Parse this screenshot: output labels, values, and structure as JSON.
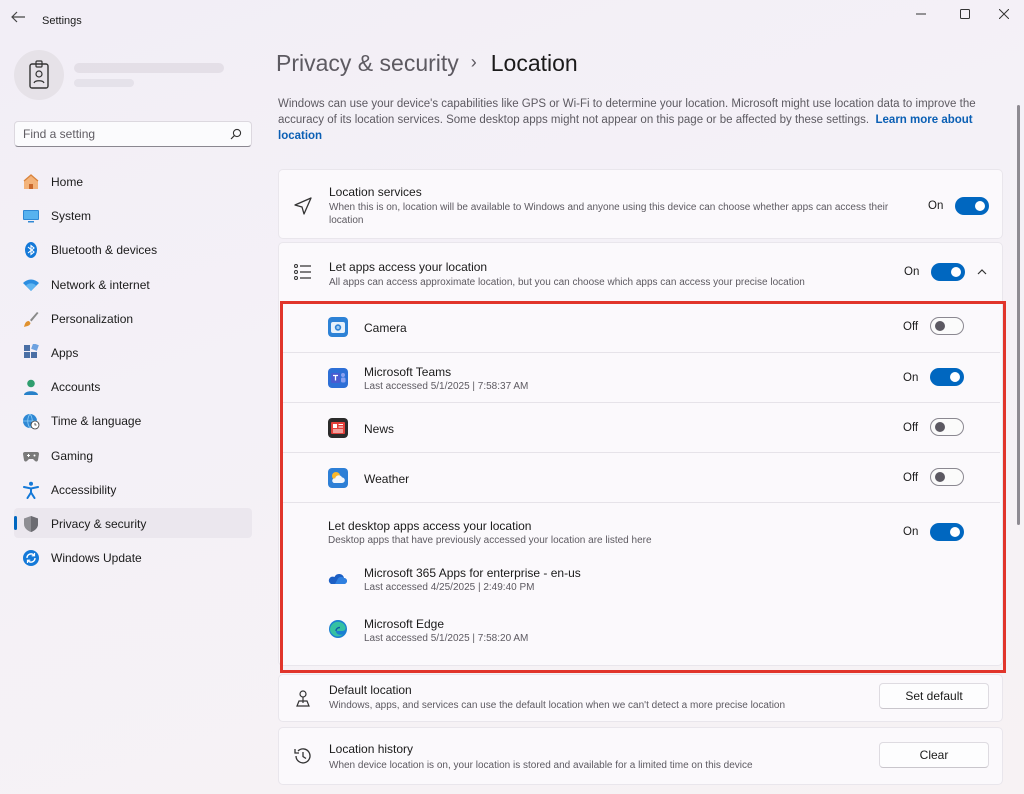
{
  "window": {
    "title": "Settings"
  },
  "search": {
    "placeholder": "Find a setting"
  },
  "sidebar": {
    "items": [
      {
        "label": "Home",
        "icon": "home-icon"
      },
      {
        "label": "System",
        "icon": "system-icon"
      },
      {
        "label": "Bluetooth & devices",
        "icon": "bluetooth-icon"
      },
      {
        "label": "Network & internet",
        "icon": "wifi-icon"
      },
      {
        "label": "Personalization",
        "icon": "brush-icon"
      },
      {
        "label": "Apps",
        "icon": "apps-icon"
      },
      {
        "label": "Accounts",
        "icon": "accounts-icon"
      },
      {
        "label": "Time & language",
        "icon": "globe-clock-icon"
      },
      {
        "label": "Gaming",
        "icon": "gamepad-icon"
      },
      {
        "label": "Accessibility",
        "icon": "accessibility-icon"
      },
      {
        "label": "Privacy & security",
        "icon": "shield-icon",
        "active": true
      },
      {
        "label": "Windows Update",
        "icon": "update-icon"
      }
    ]
  },
  "breadcrumb": {
    "parent": "Privacy & security",
    "separator": "›",
    "current": "Location"
  },
  "intro": {
    "text": "Windows can use your device's capabilities like GPS or Wi-Fi to determine your location. Microsoft might use location data to improve the accuracy of its location services. Some desktop apps might not appear on this page or be affected by these settings.",
    "link": "Learn more about location"
  },
  "location_services": {
    "title": "Location services",
    "description": "When this is on, location will be available to Windows and anyone using this device can choose whether apps can access their location",
    "state": "On",
    "on": true
  },
  "let_apps": {
    "title": "Let apps access your location",
    "description": "All apps can access approximate location, but you can choose which apps can access your precise location",
    "state": "On",
    "on": true,
    "expanded": true,
    "apps": [
      {
        "name": "Camera",
        "sub": "",
        "state": "Off",
        "on": false,
        "icon": "camera-app-icon"
      },
      {
        "name": "Microsoft Teams",
        "sub": "Last accessed 5/1/2025  |  7:58:37 AM",
        "state": "On",
        "on": true,
        "icon": "teams-app-icon"
      },
      {
        "name": "News",
        "sub": "",
        "state": "Off",
        "on": false,
        "icon": "news-app-icon"
      },
      {
        "name": "Weather",
        "sub": "",
        "state": "Off",
        "on": false,
        "icon": "weather-app-icon"
      }
    ]
  },
  "desktop_apps": {
    "title": "Let desktop apps access your location",
    "description": "Desktop apps that have previously accessed your location are listed here",
    "state": "On",
    "on": true,
    "apps": [
      {
        "name": "Microsoft 365 Apps for enterprise - en-us",
        "sub": "Last accessed 4/25/2025  |  2:49:40 PM",
        "icon": "onedrive-cloud-icon"
      },
      {
        "name": "Microsoft Edge",
        "sub": "Last accessed 5/1/2025  |  7:58:20 AM",
        "icon": "edge-icon"
      }
    ]
  },
  "default_location": {
    "title": "Default location",
    "description": "Windows, apps, and services can use the default location when we can't detect a more precise location",
    "button": "Set default"
  },
  "location_history": {
    "title": "Location history",
    "description": "When device location is on, your location is stored and available for a limited time on this device",
    "button": "Clear"
  },
  "colors": {
    "accent": "#0067c0",
    "highlight": "#e1352b"
  }
}
